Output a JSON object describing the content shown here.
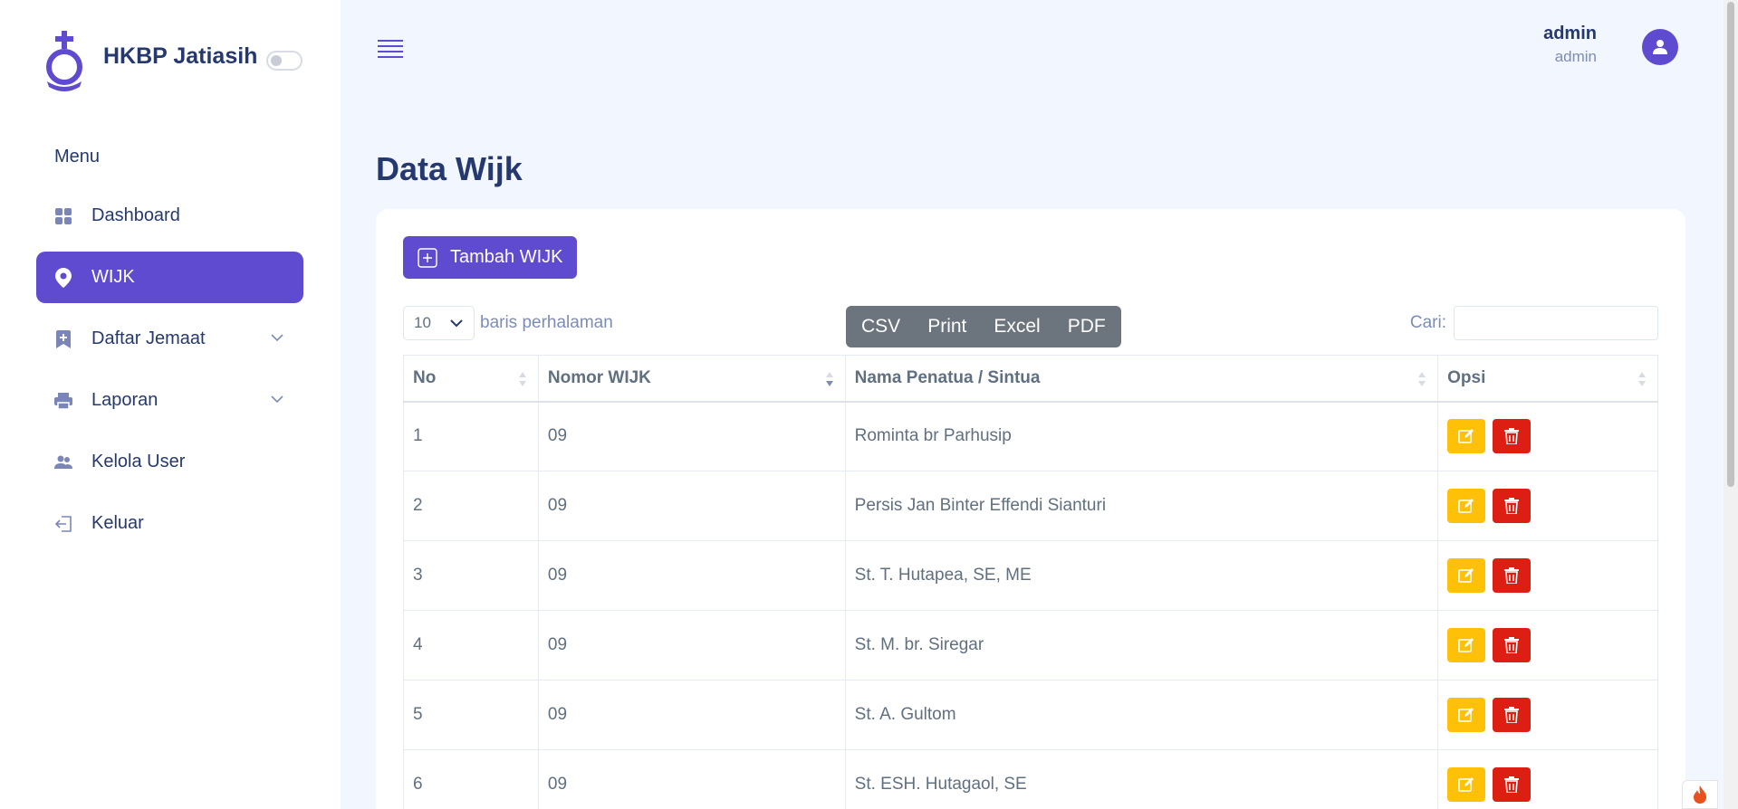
{
  "brand": {
    "name": "HKBP Jatiasih"
  },
  "sidebar": {
    "menu_title": "Menu",
    "items": [
      {
        "label": "Dashboard",
        "icon": "grid-icon",
        "active": false,
        "has_children": false
      },
      {
        "label": "WIJK",
        "icon": "map-pin-icon",
        "active": true,
        "has_children": false
      },
      {
        "label": "Daftar Jemaat",
        "icon": "bookmark-plus-icon",
        "active": false,
        "has_children": true
      },
      {
        "label": "Laporan",
        "icon": "printer-icon",
        "active": false,
        "has_children": true
      },
      {
        "label": "Kelola User",
        "icon": "people-icon",
        "active": false,
        "has_children": false
      },
      {
        "label": "Keluar",
        "icon": "logout-icon",
        "active": false,
        "has_children": false
      }
    ]
  },
  "header": {
    "user_name": "admin",
    "user_role": "admin"
  },
  "page": {
    "title": "Data Wijk"
  },
  "toolbar": {
    "add_label": "Tambah WIJK",
    "length_value": "10",
    "length_label": "baris perhalaman",
    "export_buttons": [
      "CSV",
      "Print",
      "Excel",
      "PDF"
    ],
    "search_label": "Cari:",
    "search_value": ""
  },
  "table": {
    "columns": [
      "No",
      "Nomor WIJK",
      "Nama Penatua / Sintua",
      "Opsi"
    ],
    "rows": [
      {
        "no": "1",
        "nomor": "09",
        "nama": "Rominta br Parhusip"
      },
      {
        "no": "2",
        "nomor": "09",
        "nama": "Persis Jan Binter Effendi Sianturi"
      },
      {
        "no": "3",
        "nomor": "09",
        "nama": "St. T. Hutapea, SE, ME"
      },
      {
        "no": "4",
        "nomor": "09",
        "nama": "St. M. br. Siregar"
      },
      {
        "no": "5",
        "nomor": "09",
        "nama": "St. A. Gultom"
      },
      {
        "no": "6",
        "nomor": "09",
        "nama": "St. ESH. Hutagaol, SE"
      }
    ]
  },
  "colors": {
    "primary": "#5f4bd0",
    "edit": "#ffc107",
    "delete": "#dc1e13",
    "export": "#6c757d"
  }
}
